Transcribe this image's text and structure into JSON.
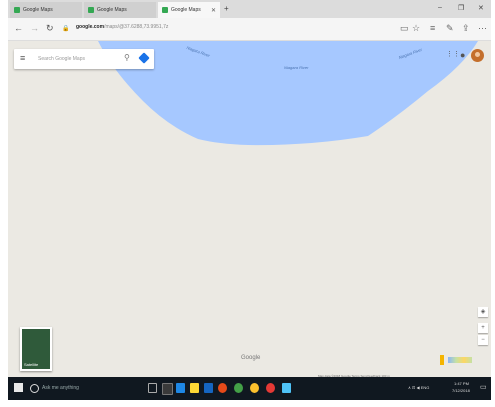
{
  "browser": {
    "tabs": [
      {
        "label": "Google Maps",
        "active": false
      },
      {
        "label": "Google Maps",
        "active": false
      },
      {
        "label": "Google Maps",
        "active": true
      }
    ],
    "new_tab": "+",
    "window_controls": [
      "–",
      "❐",
      "✕"
    ],
    "nav": {
      "back": "←",
      "forward": "→",
      "refresh": "↻",
      "lock": "🔒"
    },
    "url_host": "google.com",
    "url_path": "/maps/@37.6288,73.9951,7z",
    "toolbar_icons": [
      "reading-view-icon",
      "favorite-star-icon",
      "hub-icon",
      "notes-icon",
      "share-icon",
      "more-icon"
    ]
  },
  "map": {
    "search_placeholder": "Search Google Maps",
    "menu_icon": "≡",
    "search_icon": "⚲",
    "labels": [
      "Niagara River",
      "Niagara River",
      "Niagara River"
    ],
    "apps_icon": "⋮⋮",
    "notifications_icon": "●",
    "layers_label": "Satellite",
    "google_logo": "Google",
    "zoom_in": "+",
    "zoom_out": "−",
    "compass": "◈",
    "footer_text": "Map data ©2018 Google   Terms   Send feedback   100 m",
    "water_color": "#a6c8ff",
    "land_color": "#ebe9e3"
  },
  "taskbar": {
    "search_placeholder": "Ask me anything",
    "tray_text": "∧ ⊡ ◀ ENG",
    "clock_time": "1:47 PM",
    "clock_date": "7/12/2018"
  }
}
